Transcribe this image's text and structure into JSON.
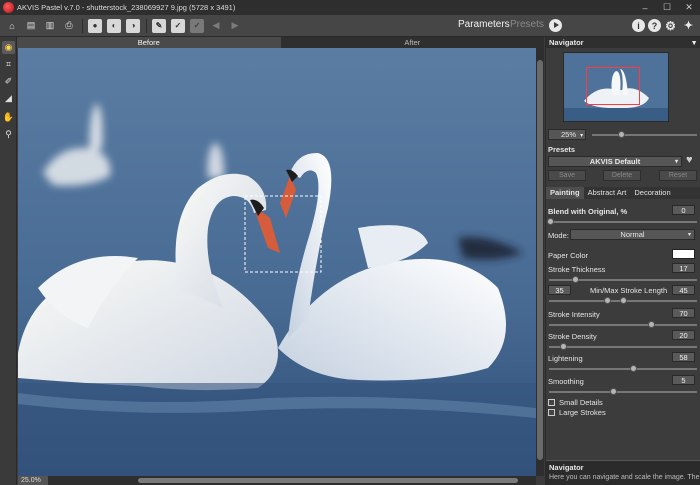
{
  "window": {
    "title": "AKVIS Pastel v.7.0 - shutterstock_238069927 9.jpg (5728 x 3491)",
    "minimize": "–",
    "maximize": "☐",
    "close": "✕"
  },
  "toolbar": {
    "parameters_tab": "Parameters",
    "presets_tab": "Presets",
    "info_glyph": "i",
    "help_glyph": "?",
    "settings_glyph": "⚙",
    "pin_glyph": "✦"
  },
  "canvas": {
    "before_label": "Before",
    "after_label": "After",
    "zoom_label": "25.0%"
  },
  "navigator": {
    "title": "Navigator",
    "zoom_value": "25%",
    "zoom_slider": 0.45
  },
  "presets": {
    "label": "Presets",
    "selected": "AKVIS Default",
    "save_label": "Save",
    "delete_label": "Delete",
    "reset_label": "Reset"
  },
  "settings_tabs": [
    "Painting",
    "Abstract Art",
    "Decoration"
  ],
  "painting": {
    "blend_label": "Blend with Original, %",
    "blend_value": "0",
    "mode_label": "Mode:",
    "mode_value": "Normal",
    "paper_color_label": "Paper Color",
    "stroke_thickness_label": "Stroke Thickness",
    "stroke_thickness_value": "17",
    "minmax_label": "Min/Max Stroke Length",
    "min_value": "35",
    "max_value": "45",
    "stroke_intensity_label": "Stroke Intensity",
    "stroke_intensity_value": "70",
    "stroke_density_label": "Stroke Density",
    "stroke_density_value": "20",
    "lightening_label": "Lightening",
    "lightening_value": "58",
    "smoothing_label": "Smoothing",
    "smoothing_value": "5",
    "small_details_label": "Small Details",
    "large_strokes_label": "Large Strokes"
  },
  "help": {
    "title": "Navigator",
    "text": "Here you can navigate and scale the image. The"
  },
  "colors": {
    "panel": "#3c3c3c",
    "title_bar": "#2e2e2e",
    "accent_red": "#ff3b3b"
  }
}
